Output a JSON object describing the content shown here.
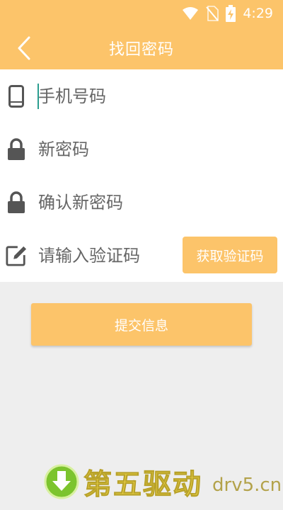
{
  "status_bar": {
    "time": "4:29",
    "icons": [
      "wifi-icon",
      "no-sim-icon",
      "battery-charging-icon"
    ]
  },
  "header": {
    "title": "找回密码",
    "back_icon": "chevron-left-icon"
  },
  "form": {
    "phone": {
      "icon": "phone-icon",
      "placeholder": "手机号码"
    },
    "new_password": {
      "icon": "lock-icon",
      "placeholder": "新密码"
    },
    "confirm_password": {
      "icon": "lock-icon",
      "placeholder": "确认新密码"
    },
    "code": {
      "icon": "edit-icon",
      "placeholder": "请输入验证码"
    },
    "get_code_label": "获取验证码"
  },
  "submit_label": "提交信息",
  "watermark": {
    "text": "第五驱动",
    "domain": "drv5.cn"
  },
  "colors": {
    "accent": "#fcc46a",
    "background": "#eeeeee",
    "icon_gray": "#555555"
  }
}
